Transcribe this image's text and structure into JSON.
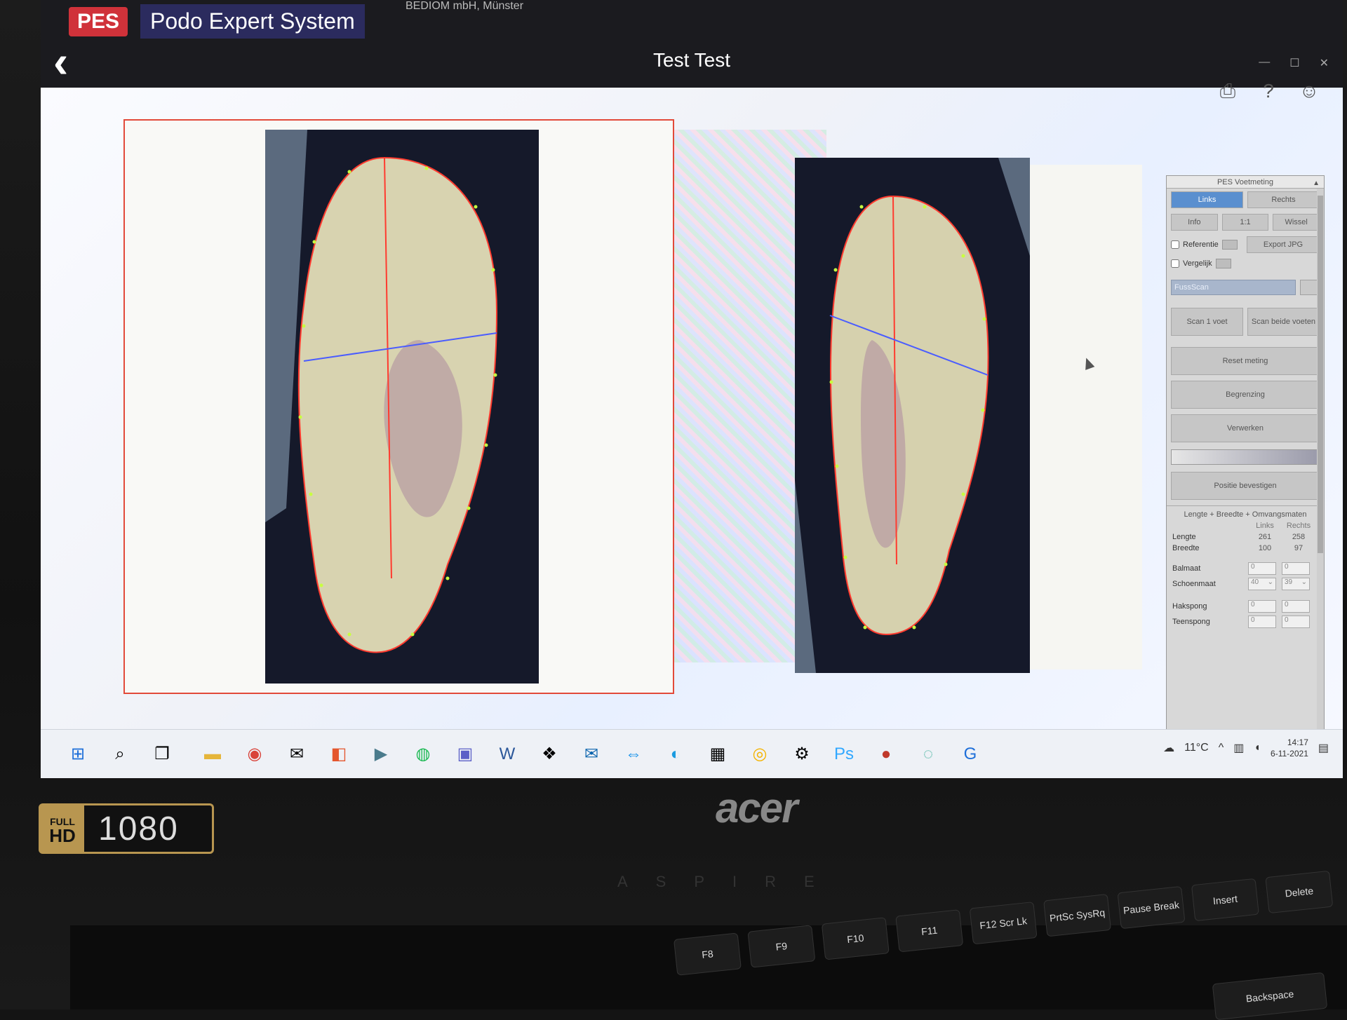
{
  "app": {
    "logo": "PES",
    "name": "Podo Expert System",
    "top_note": "BEDIOM mbH, Münster",
    "patient": "Test Test",
    "back_symbol": "‹"
  },
  "toolbar": {
    "print_icon": "printer-icon",
    "help_icon": "help-icon",
    "user_icon": "user-icon"
  },
  "panel": {
    "title": "PES Voetmeting",
    "tab_left": "Links",
    "tab_right": "Rechts",
    "info": "Info",
    "scale": "1:1",
    "wissel": "Wissel",
    "referentie": "Referentie",
    "vergelijk": "Vergelijk",
    "export": "Export JPG",
    "scan_field": "FussScan",
    "scan_one": "Scan 1 voet",
    "scan_both": "Scan beide voeten",
    "reset": "Reset meting",
    "begrenzing": "Begrenzing",
    "verwerken": "Verwerken",
    "confirm": "Positie bevestigen",
    "section": "Lengte + Breedte + Omvangsmaten",
    "col_left": "Links",
    "col_right": "Rechts",
    "rows": {
      "lengte": {
        "label": "Lengte",
        "left": "261",
        "right": "258"
      },
      "breedte": {
        "label": "Breedte",
        "left": "100",
        "right": "97"
      },
      "balmaat": {
        "label": "Balmaat",
        "left": "0",
        "right": "0"
      },
      "schoenmaat": {
        "label": "Schoenmaat",
        "left": "40",
        "right": "39"
      },
      "hakspong": {
        "label": "Hakspong",
        "left": "0",
        "right": "0"
      },
      "teenspong": {
        "label": "Teenspong",
        "left": "0",
        "right": "0"
      }
    }
  },
  "taskbar": {
    "temperature": "11°C",
    "time": "14:17",
    "date": "6-11-2021"
  },
  "bezel": {
    "full": "FULL",
    "hd": "HD",
    "resolution": "1080",
    "brand": "acer",
    "model": "ASPIRE"
  },
  "keyboard": {
    "f8": "F8",
    "f9": "F9",
    "f10": "F10",
    "f11": "F11",
    "f12": "F12 Scr Lk",
    "prtsc": "PrtSc SysRq",
    "pause": "Pause Break",
    "insert": "Insert",
    "delete": "Delete",
    "backspace": "Backspace"
  }
}
